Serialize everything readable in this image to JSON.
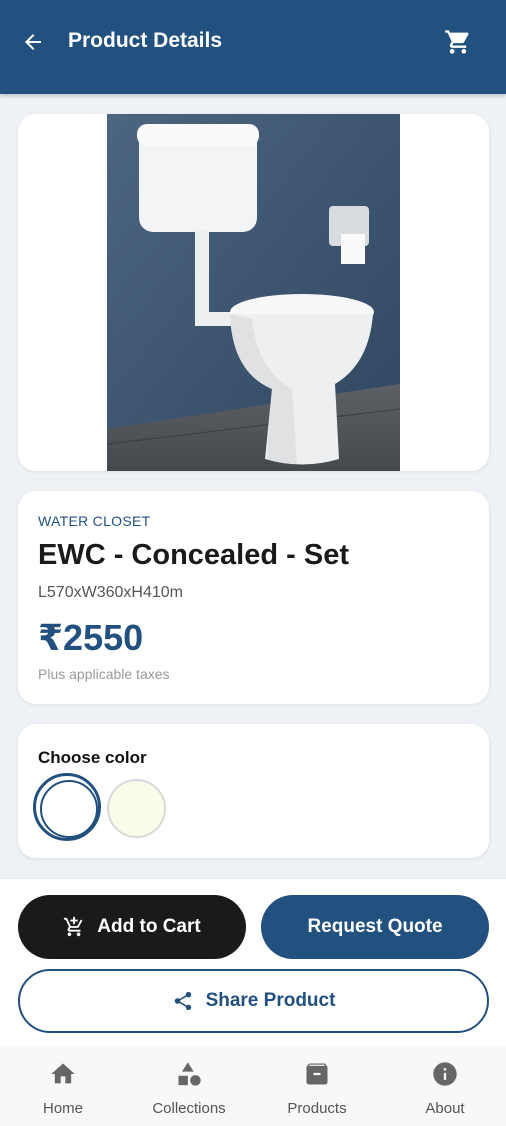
{
  "header": {
    "title": "Product Details",
    "back_icon": "arrow-left-icon",
    "cart_icon": "shopping-cart-icon"
  },
  "product": {
    "category": "WATER CLOSET",
    "name": "EWC - Concealed - Set",
    "dimensions": "L570xW360xH410m",
    "price": "₹2550",
    "tax_note": "Plus applicable taxes"
  },
  "colors": {
    "label": "Choose color",
    "options": [
      "#ffffff",
      "#fbfbea"
    ],
    "selected": 0
  },
  "actions": {
    "add_to_cart": "Add to Cart",
    "request_quote": "Request Quote",
    "share": "Share Product"
  },
  "nav": {
    "items": [
      {
        "label": "Home",
        "icon": "home-icon"
      },
      {
        "label": "Collections",
        "icon": "shapes-icon"
      },
      {
        "label": "Products",
        "icon": "archive-box-icon"
      },
      {
        "label": "About",
        "icon": "info-icon"
      }
    ]
  },
  "theme": {
    "primary": "#22507f",
    "dark": "#1a1a1a"
  }
}
